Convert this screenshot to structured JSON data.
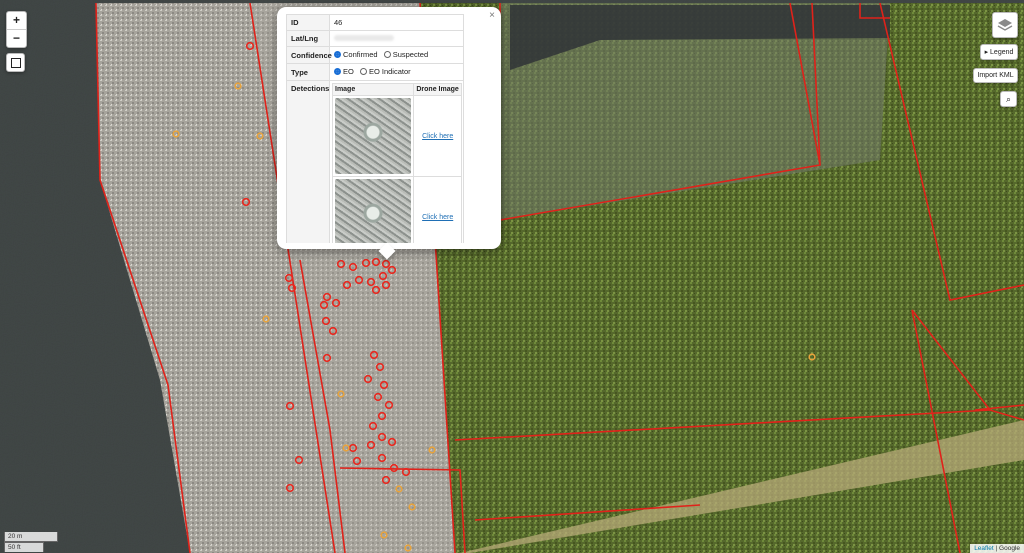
{
  "controls": {
    "zoom_in": "+",
    "zoom_out": "−",
    "legend_label": "▸ Legend",
    "import_kml_label": "Import KML"
  },
  "popup": {
    "close": "×",
    "id_label": "ID",
    "id_value": "46",
    "latlng_label": "Lat/Lng",
    "confidence_label": "Confidence",
    "confidence_options": [
      "Confirmed",
      "Suspected"
    ],
    "type_label": "Type",
    "type_options": [
      "EO",
      "EO Indicator"
    ],
    "detections_label": "Detections",
    "image_header": "Image",
    "drone_header": "Drone Image",
    "link_text": "Click here"
  },
  "scale": {
    "meters": "20 m",
    "feet": "50 ft"
  },
  "attribution": {
    "leaflet": "Leaflet",
    "separator": " | ",
    "google": "Google"
  },
  "colors": {
    "boundary": "#e0221a",
    "confirmed": "#e8281f",
    "suspected": "#e8a33c",
    "accent": "#1a6fd6"
  }
}
